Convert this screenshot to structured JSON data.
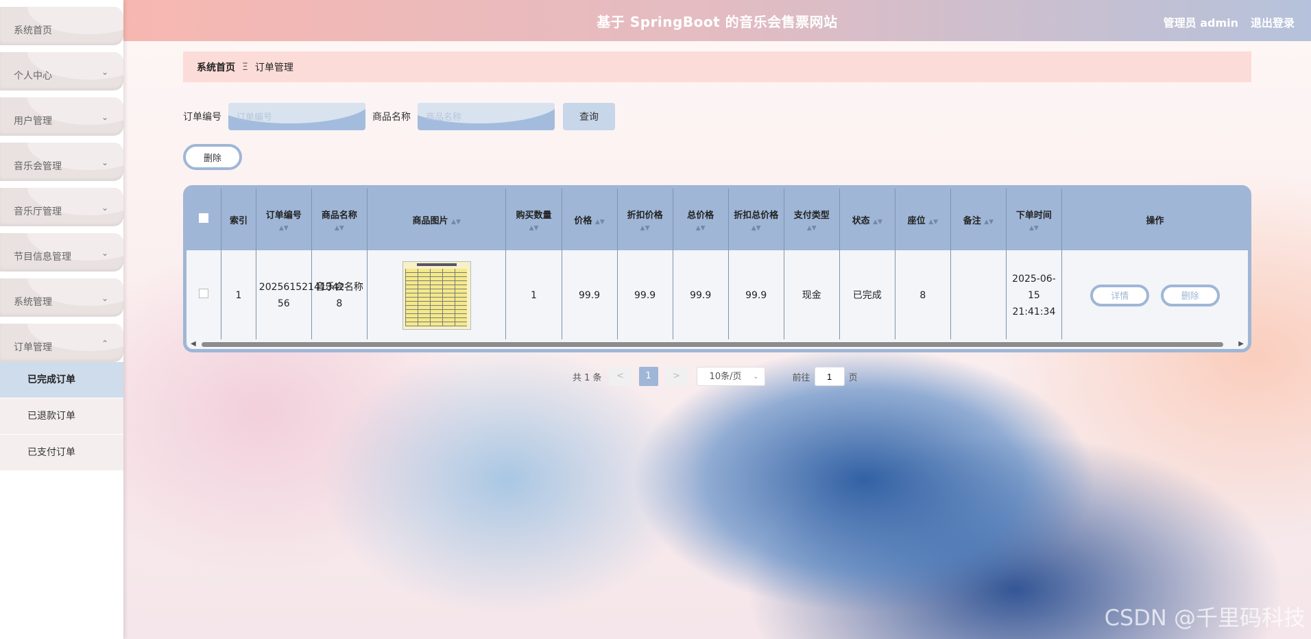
{
  "header": {
    "title": "基于 SpringBoot 的音乐会售票网站",
    "user": "管理员 admin",
    "logout": "退出登录"
  },
  "sidebar": {
    "items": [
      {
        "label": "系统首页",
        "chevron": ""
      },
      {
        "label": "个人中心",
        "chevron": "v"
      },
      {
        "label": "用户管理",
        "chevron": "v"
      },
      {
        "label": "音乐会管理",
        "chevron": "v"
      },
      {
        "label": "音乐厅管理",
        "chevron": "v"
      },
      {
        "label": "节目信息管理",
        "chevron": "v"
      },
      {
        "label": "系统管理",
        "chevron": "v"
      },
      {
        "label": "订单管理",
        "chevron": "^"
      }
    ],
    "submenu": [
      "已完成订单",
      "已退款订单",
      "已支付订单"
    ]
  },
  "breadcrumb": {
    "home": "系统首页",
    "separator": "Ξ",
    "current": "订单管理"
  },
  "search": {
    "order_label": "订单编号",
    "order_placeholder": "订单编号",
    "goods_label": "商品名称",
    "goods_placeholder": "商品名称",
    "query_label": "查询"
  },
  "actions": {
    "delete_label": "删除"
  },
  "table": {
    "headers": [
      "索引",
      "订单编号",
      "商品名称",
      "商品图片",
      "购买数量",
      "价格",
      "折扣价格",
      "总价格",
      "折扣总价格",
      "支付类型",
      "状态",
      "座位",
      "备注",
      "下单时间",
      "操作"
    ],
    "rows": [
      {
        "index": "1",
        "order_no": "20256152141342 56",
        "goods_name": "音乐会名称8",
        "qty": "1",
        "price": "99.9",
        "discount_price": "99.9",
        "total": "99.9",
        "discount_total": "99.9",
        "pay_type": "现金",
        "status": "已完成",
        "seat": "8",
        "note": "",
        "time": "2025-06-15 21:41:34",
        "detail_label": "详情",
        "delete_label": "删除"
      }
    ]
  },
  "pager": {
    "total": "共 1 条",
    "prev": "<",
    "page": "1",
    "next": ">",
    "size": "10条/页",
    "goto": "前往",
    "jump_value": "1",
    "page_unit": "页"
  },
  "watermark": "CSDN @千里码科技"
}
